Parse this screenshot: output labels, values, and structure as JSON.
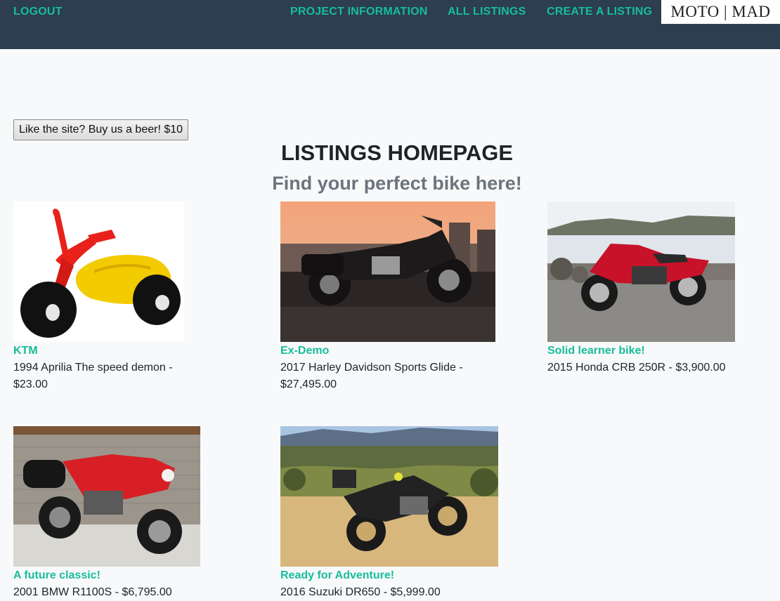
{
  "nav": {
    "logout": "LOGOUT",
    "links": [
      "PROJECT INFORMATION",
      "ALL LISTINGS",
      "CREATE A LISTING"
    ],
    "logo_text": "MOTO | MAD"
  },
  "donate_button": "Like the site? Buy us a beer! $10",
  "page": {
    "title": "LISTINGS HOMEPAGE",
    "subtitle": "Find your perfect bike here!"
  },
  "listings": [
    {
      "title": "KTM",
      "description": "1994 Aprilia The speed demon - $23.00",
      "image": "toy-tricycle"
    },
    {
      "title": "Ex-Demo",
      "description": "2017 Harley Davidson Sports Glide - $27,495.00",
      "image": "cruiser-sunset"
    },
    {
      "title": "Solid learner bike!",
      "description": "2015 Honda CRB 250R - $3,900.00",
      "image": "sportbike-seaside"
    },
    {
      "title": "A future classic!",
      "description": "2001 BMW R1100S - $6,795.00",
      "image": "bmw-garage"
    },
    {
      "title": "Ready for Adventure!",
      "description": "2016 Suzuki DR650 - $5,999.00",
      "image": "dualsport-hills"
    }
  ],
  "colors": {
    "navbar": "#2c3e50",
    "accent": "#18bc9c",
    "background": "#f8f9fa",
    "subtitle": "#6c757d"
  }
}
